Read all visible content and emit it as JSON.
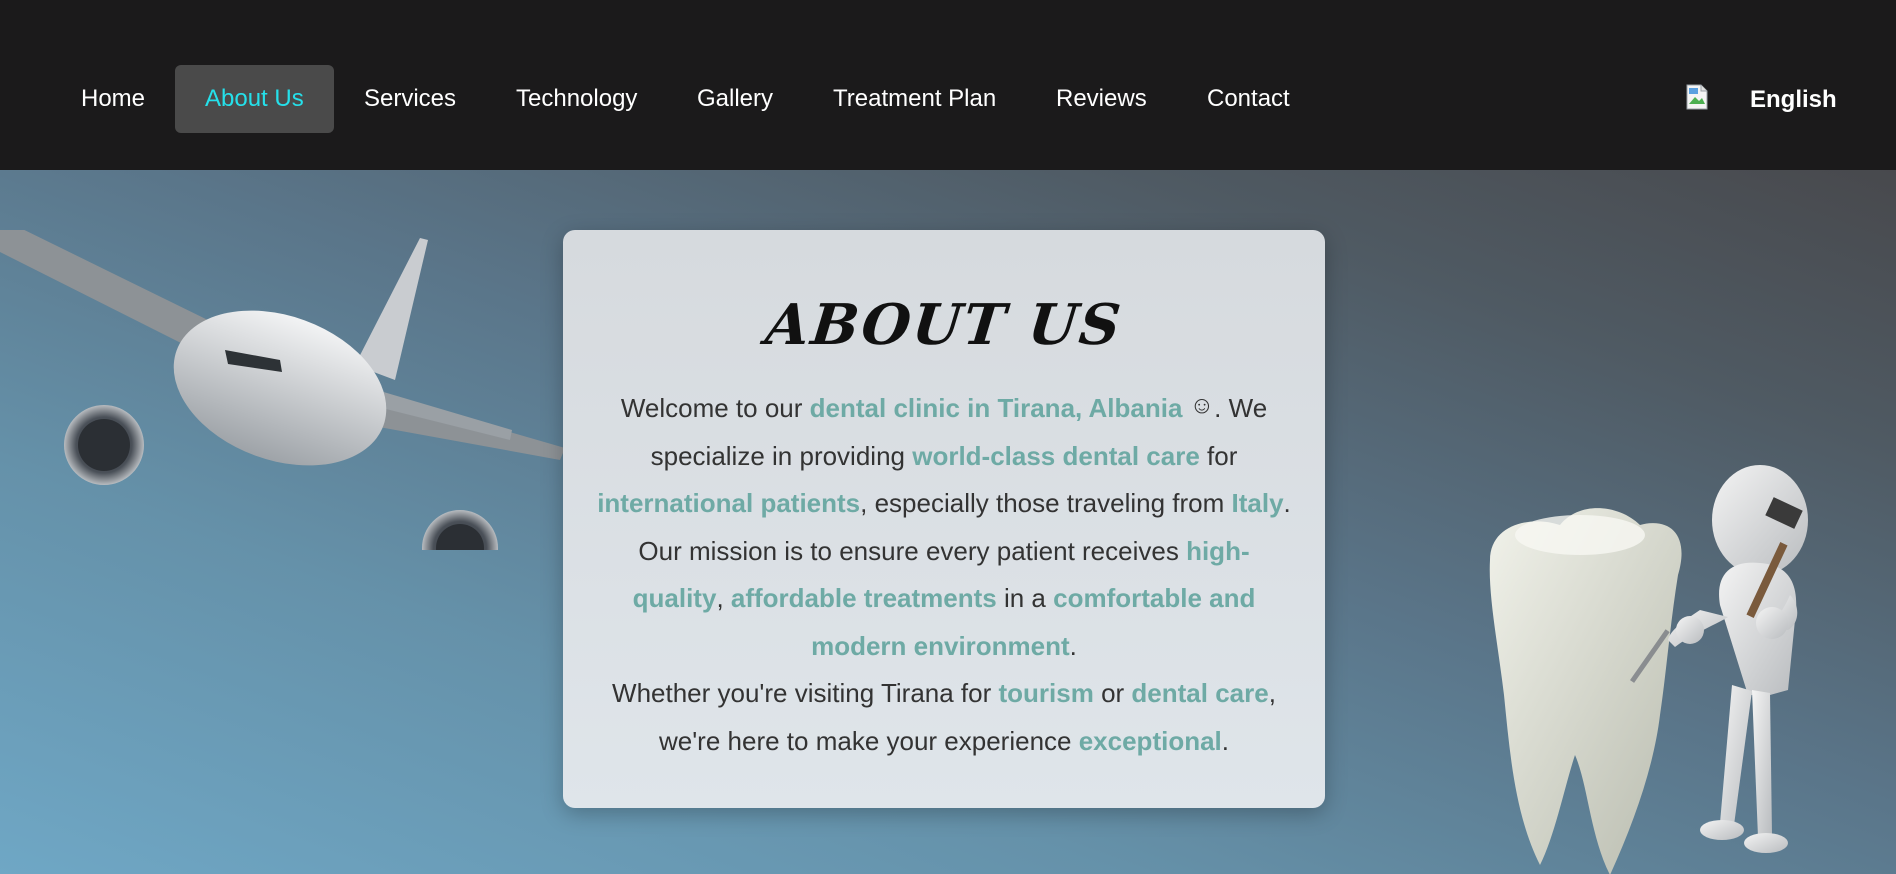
{
  "nav": {
    "items": [
      {
        "label": "Home"
      },
      {
        "label": "About Us",
        "active": true
      },
      {
        "label": "Services"
      },
      {
        "label": "Technology"
      },
      {
        "label": "Gallery"
      },
      {
        "label": "Treatment Plan"
      },
      {
        "label": "Reviews"
      },
      {
        "label": "Contact"
      }
    ],
    "language": "English"
  },
  "about": {
    "title": "ABOUT US",
    "p1": {
      "s1": "Welcome to our ",
      "h1": "dental clinic in Tirana, Albania",
      "emoji": "☺",
      "s2": ". We specialize in providing ",
      "h2": "world-class dental care",
      "s3": " for ",
      "h3": "international patients",
      "s4": ", especially those traveling from ",
      "h4": "Italy",
      "s5": ". Our mission is to ensure every patient receives ",
      "h5": "high-quality",
      "s6": ", ",
      "h6": "affordable treatments",
      "s7": " in a ",
      "h7": "comfortable and modern environment",
      "s8": "."
    },
    "p2": {
      "s1": "Whether you're visiting Tirana for ",
      "h1": "tourism",
      "s2": " or ",
      "h2": "dental care",
      "s3": ", we're here to make your experience ",
      "h3": "exceptional",
      "s4": "."
    }
  },
  "icons": {
    "language_flag": "broken-image-icon",
    "decor_left": "airplane-illustration",
    "decor_right": "tooth-figure-illustration"
  },
  "colors": {
    "nav_bg": "#1b1a1b",
    "active_text": "#25e0ea",
    "highlight": "#6eaaa5"
  }
}
